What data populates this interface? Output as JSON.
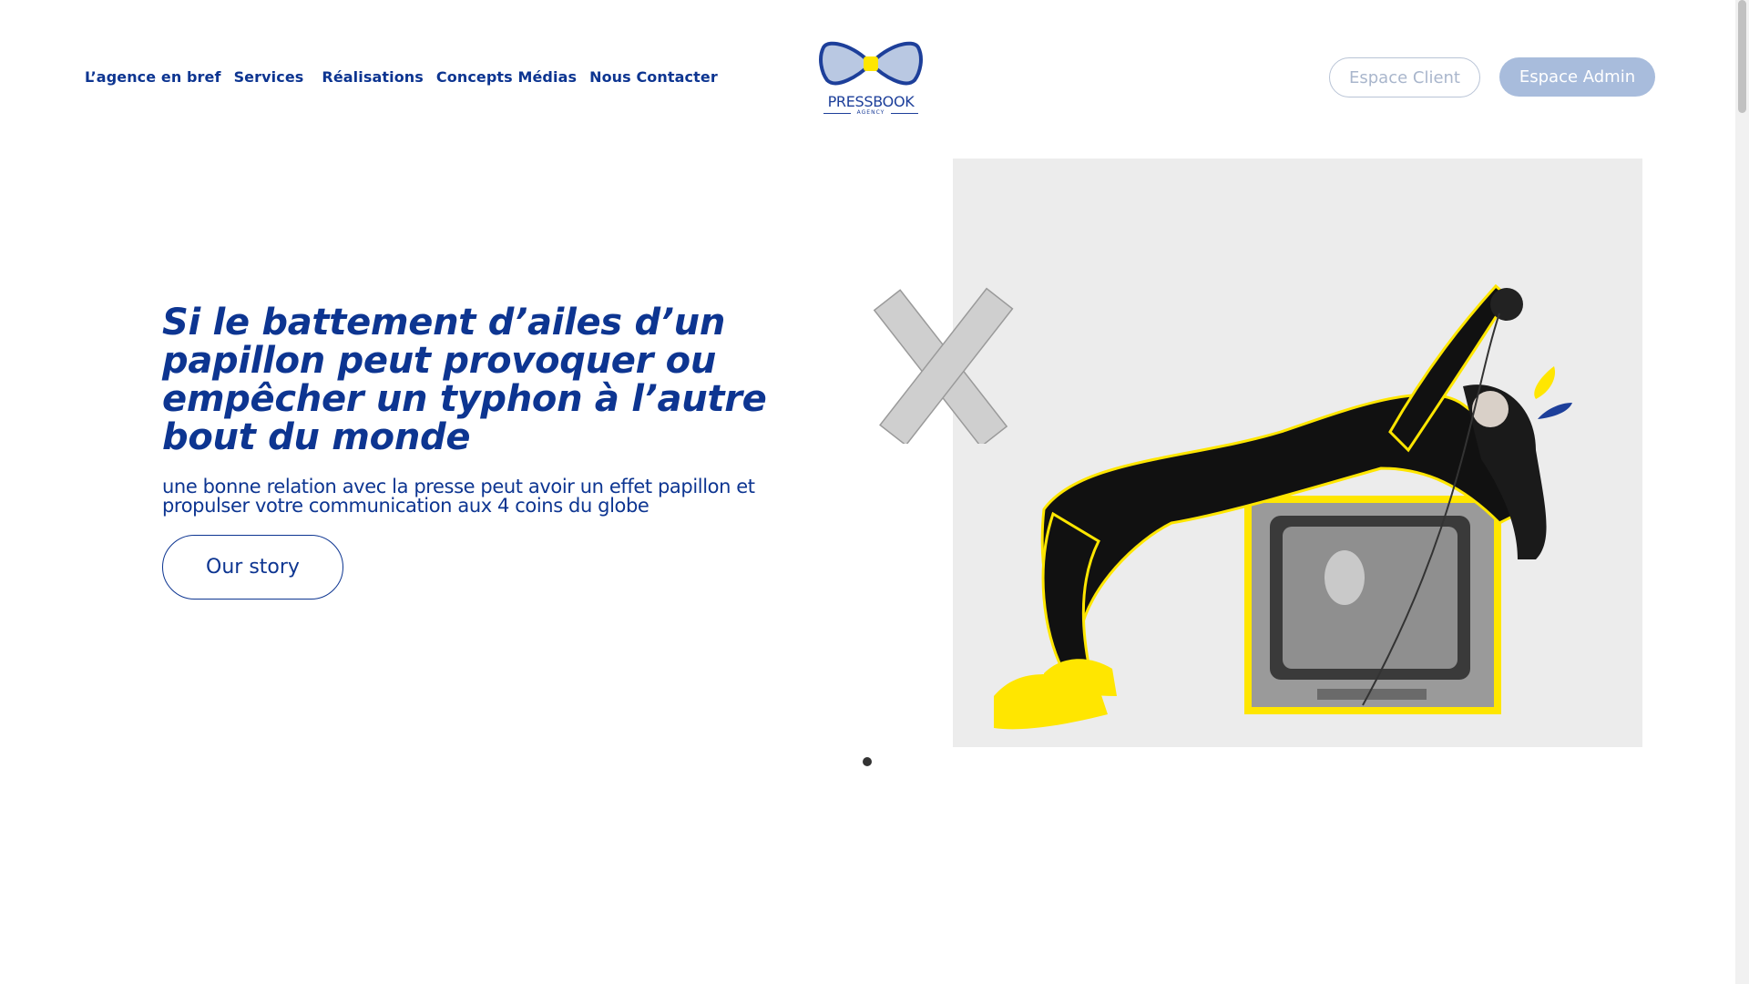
{
  "nav": {
    "items": [
      {
        "label": "L’agence en bref"
      },
      {
        "label": "Services"
      },
      {
        "label": "Réalisations"
      },
      {
        "label": "Concepts Médias"
      },
      {
        "label": "Nous Contacter"
      }
    ]
  },
  "logo": {
    "name": "PRESSBOOK",
    "sub": "AGENCY"
  },
  "header_buttons": {
    "client": "Espace Client",
    "admin": "Espace Admin"
  },
  "hero": {
    "title": "Si le battement d’ailes d’un papillon peut provoquer ou empêcher un typhon à l’autre bout du monde",
    "subtitle": "une bonne relation avec la presse peut avoir un effet papillon et propulser votre communication aux 4 coins du globe",
    "cta": "Our story"
  },
  "colors": {
    "brand_blue": "#0d3591",
    "accent_yellow": "#ffe600",
    "admin_button": "#a8bcdc"
  }
}
